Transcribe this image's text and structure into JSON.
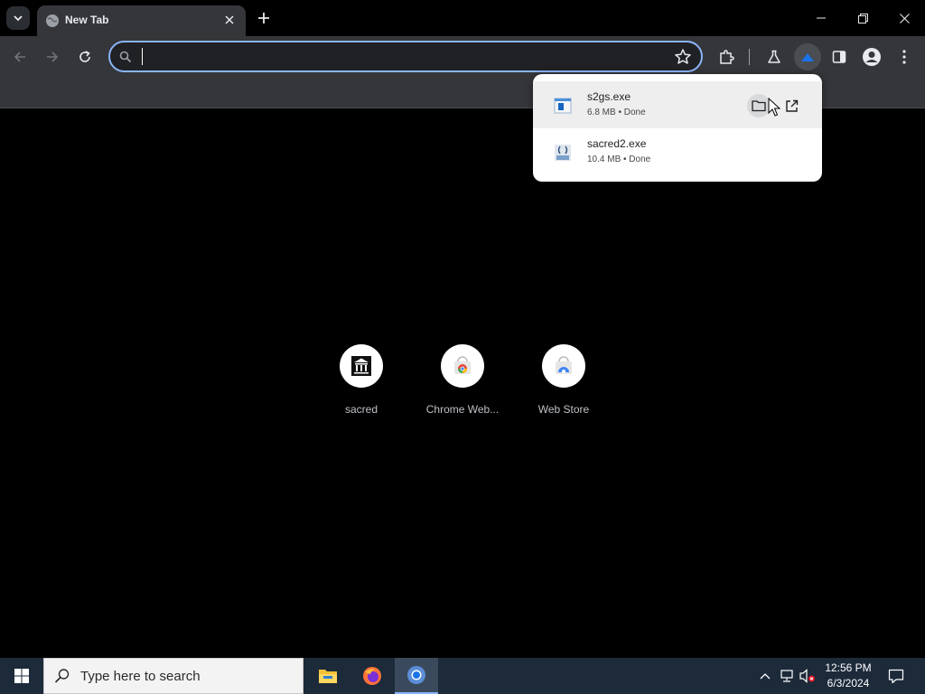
{
  "tab": {
    "title": "New Tab"
  },
  "omnibox": {
    "value": "",
    "placeholder": ""
  },
  "downloads": [
    {
      "name": "s2gs.exe",
      "meta": "6.8 MB • Done"
    },
    {
      "name": "sacred2.exe",
      "meta": "10.4 MB • Done"
    }
  ],
  "shortcuts": [
    {
      "label": "sacred"
    },
    {
      "label": "Chrome Web..."
    },
    {
      "label": "Web Store"
    }
  ],
  "taskbar": {
    "search_placeholder": "Type here to search",
    "time": "12:56 PM",
    "date": "6/3/2024"
  },
  "colors": {
    "accent": "#8ab4f8",
    "toolbar_bg": "#35363a",
    "taskbar_bg": "#1c2a3a"
  }
}
